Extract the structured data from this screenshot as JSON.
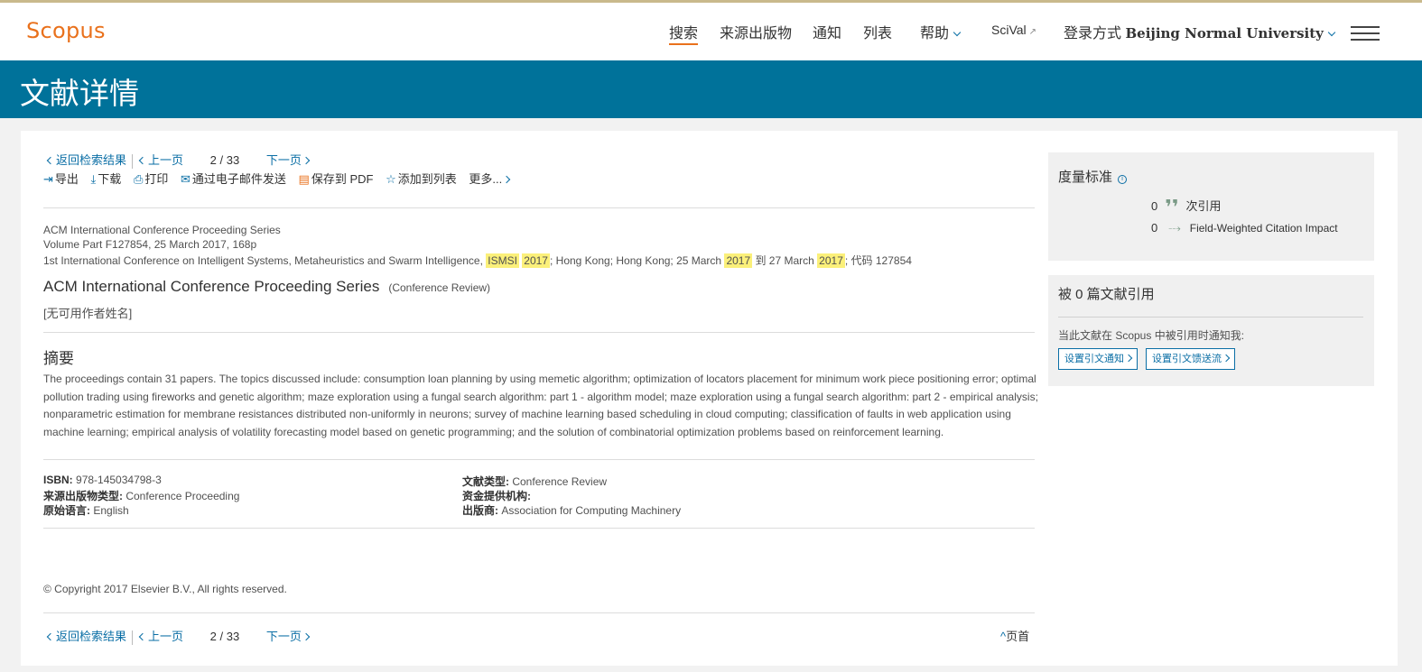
{
  "header": {
    "logo": "Scopus",
    "nav": {
      "search": "搜索",
      "sources": "来源出版物",
      "alerts": "通知",
      "lists": "列表",
      "help": "帮助",
      "scival": "SciVal",
      "login_prefix": "登录方式",
      "login_institution": "Beijing Normal University"
    }
  },
  "banner": {
    "title": "文献详情"
  },
  "pager": {
    "back": "返回检索结果",
    "prev": "上一页",
    "current": "2",
    "separator": "/",
    "total": "33",
    "next": "下一页"
  },
  "toolbar": {
    "export": "导出",
    "download": "下载",
    "print": "打印",
    "email": "通过电子邮件发送",
    "save_pdf": "保存到 PDF",
    "add_list": "添加到列表",
    "more": "更多..."
  },
  "source": {
    "series": "ACM International Conference Proceeding Series",
    "volume": "Volume Part F127854, 25 March 2017, 168p",
    "conf_prefix": "1st International Conference on Intelligent Systems, Metaheuristics and Swarm Intelligence, ",
    "conf_acronym": "ISMSI",
    "conf_year": "2017",
    "conf_loc": "; Hong Kong; Hong Kong; 25 March ",
    "conf_year2": "2017",
    "conf_to": " 到 27 March ",
    "conf_year3": "2017",
    "conf_code": "; 代码 127854"
  },
  "document": {
    "title": "ACM International Conference Proceeding Series",
    "type": "(Conference Review)",
    "authors": "[无可用作者姓名]"
  },
  "abstract": {
    "heading": "摘要",
    "text": "The proceedings contain 31 papers. The topics discussed include: consumption loan planning by using memetic algorithm; optimization of locators placement for minimum work piece positioning error; optimal pollution trading using fireworks and genetic algorithm; maze exploration using a fungal search algorithm: part 1 - algorithm model; maze exploration using a fungal search algorithm: part 2 - empirical analysis; nonparametric estimation for membrane resistances distributed non-uniformly in neurons; survey of machine learning based scheduling in cloud computing; classification of faults in web application using machine learning; empirical analysis of volatility forecasting model based on genetic programming; and the solution of combinatorial optimization problems based on reinforcement learning."
  },
  "details": {
    "isbn_label": "ISBN:",
    "isbn": "978-145034798-3",
    "source_type_label": "来源出版物类型:",
    "source_type": "Conference Proceeding",
    "language_label": "原始语言:",
    "language": "English",
    "doc_type_label": "文献类型:",
    "doc_type": "Conference Review",
    "funding_label": "资金提供机构:",
    "publisher_label": "出版商:",
    "publisher": "Association for Computing Machinery"
  },
  "copyright": "© Copyright 2017 Elsevier B.V., All rights reserved.",
  "top_link": "页首",
  "metrics": {
    "title": "度量标准",
    "citations_count": "0",
    "citations_label": "次引用",
    "fwci_count": "0",
    "fwci_label": "Field-Weighted Citation Impact"
  },
  "cited_by": {
    "title": "被 0 篇文献引用",
    "notify_text": "当此文献在 Scopus 中被引用时通知我:",
    "alert_button": "设置引文通知",
    "feed_button": "设置引文馈送流"
  }
}
